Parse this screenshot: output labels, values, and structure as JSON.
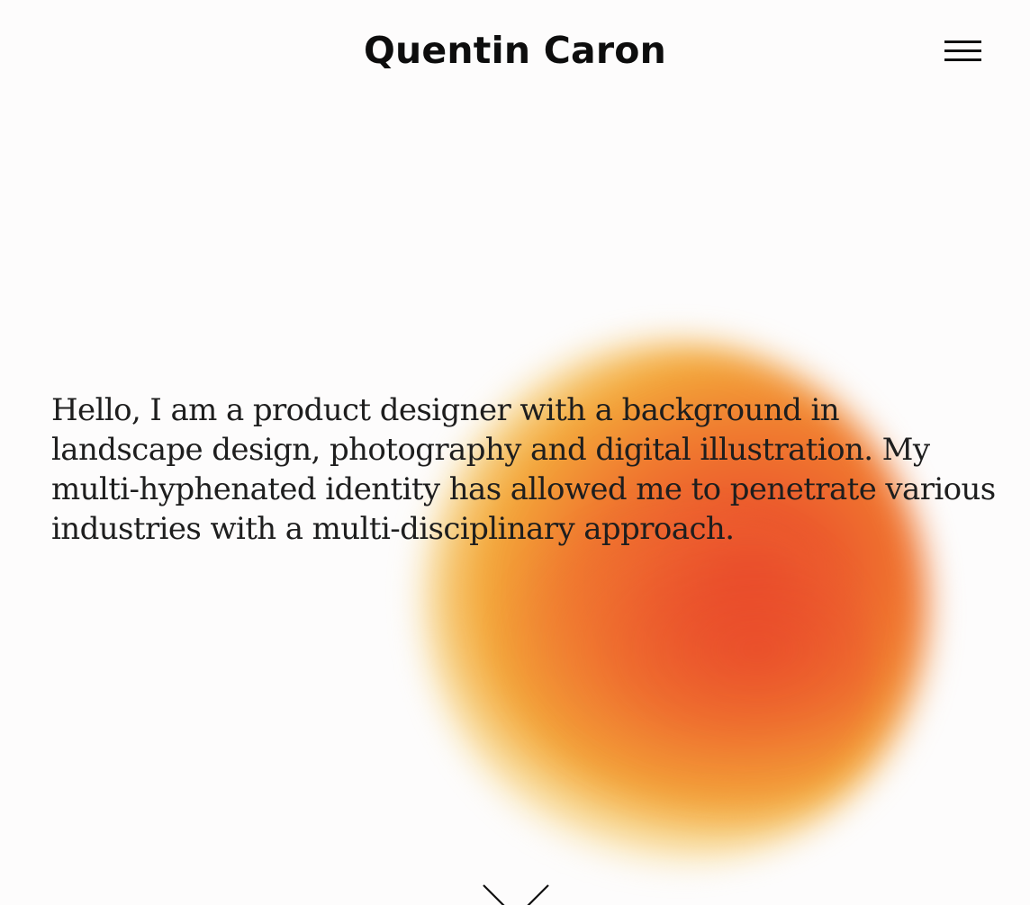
{
  "header": {
    "title": "Quentin Caron",
    "menu_icon": "hamburger-menu-icon"
  },
  "hero": {
    "intro_text": "Hello, I am a product designer with a background in landscape design, photography and digital illustration. My multi-hyphenated identity has allowed me to penetrate various industries with a multi-disciplinary approach."
  },
  "scroll_indicator": {
    "icon": "chevron-down-icon"
  },
  "colors": {
    "background": "#fdfcfc",
    "text": "#1e1e1e",
    "gradient_red": "#e8442a",
    "gradient_orange": "#f07a2f",
    "gradient_yellow": "#f3a93a"
  }
}
